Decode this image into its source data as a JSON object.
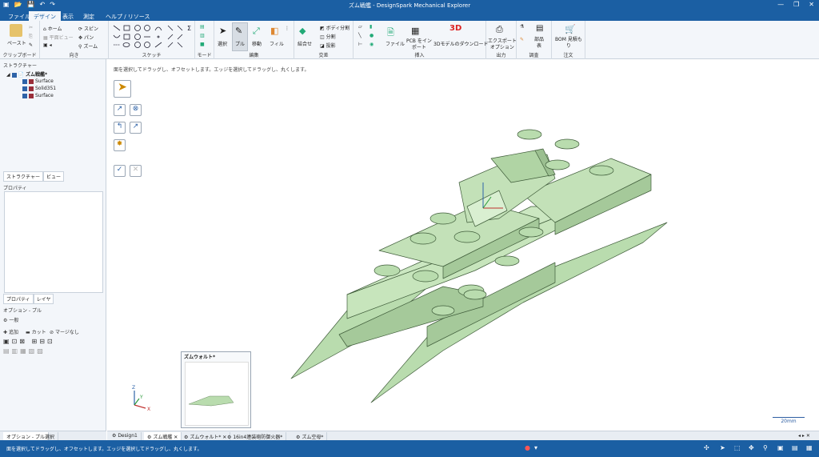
{
  "window": {
    "title": "ズム戦艦 - DesignSpark Mechanical Explorer",
    "controls": [
      "—",
      "❐",
      "✕"
    ],
    "quick_access": [
      "▣",
      "📂",
      "💾",
      "↶",
      "↷"
    ]
  },
  "ribbon_tabs": [
    "ファイル",
    "デザイン",
    "表示",
    "測定",
    "ヘルプ / リソース"
  ],
  "ribbon": {
    "clipboard": {
      "label": "クリップボード",
      "paste": "ペースト"
    },
    "orient": {
      "label": "向き",
      "home": "ホーム",
      "plane_view": "平面ビュー",
      "spin": "スピン",
      "pan": "パン",
      "zoom": "ズーム"
    },
    "sketch": {
      "label": "スケッチ"
    },
    "mode": {
      "label": "モード"
    },
    "edit": {
      "label": "編集",
      "select": "選択",
      "pull": "プル",
      "move": "移動",
      "fill": "フィル"
    },
    "intersect": {
      "label": "交差",
      "combine": "結合せ",
      "split_body": "ボディ分割",
      "split": "分割",
      "project": "投影"
    },
    "insert": {
      "label": "挿入",
      "file": "ファイル",
      "pcb": "PCB をイン\nポート",
      "download_3d": "3Dモデルのダウンロード",
      "badge_3d": "3D"
    },
    "output": {
      "label": "出力",
      "export": "エクスポート\nオプション"
    },
    "investigate": {
      "label": "調査",
      "parts": "部品\n表"
    },
    "order": {
      "label": "注文",
      "bom": "BOM 見積も\nり"
    }
  },
  "structure": {
    "header": "ストラクチャー",
    "root": "ズム戦艦*",
    "items": [
      "Surface",
      "Solid351",
      "Surface"
    ],
    "tabs": [
      "ストラクチャー",
      "ビュー"
    ]
  },
  "properties": {
    "header": "プロパティ",
    "tabs": [
      "プロパティ",
      "レイヤ"
    ]
  },
  "options": {
    "header": "オプション - プル",
    "general": "一般",
    "add": "追加",
    "cut": "カット",
    "no_merge": "マージなし",
    "tabs": [
      "オプション - プル",
      "選択"
    ]
  },
  "viewport": {
    "hint": "面を選択してドラッグし、オフセットします。エッジを選択してドラッグし、丸くします。",
    "scale": "20mm",
    "thumb_title": "ズムウォルト*",
    "axis_labels": [
      "Z",
      "Y",
      "X"
    ]
  },
  "doc_tabs": [
    "Design1",
    "ズム戦艦",
    "ズムウォルト*",
    "16in4連装砲防御火器*",
    "ズム空母*"
  ],
  "status": {
    "text": "面を選択してドラッグし、オフセットします。エッジを選択してドラッグし、丸くします。"
  },
  "colors": {
    "accent": "#1b5fa3",
    "model_fill": "#b9dcae",
    "model_stroke": "#3f5c3a"
  }
}
